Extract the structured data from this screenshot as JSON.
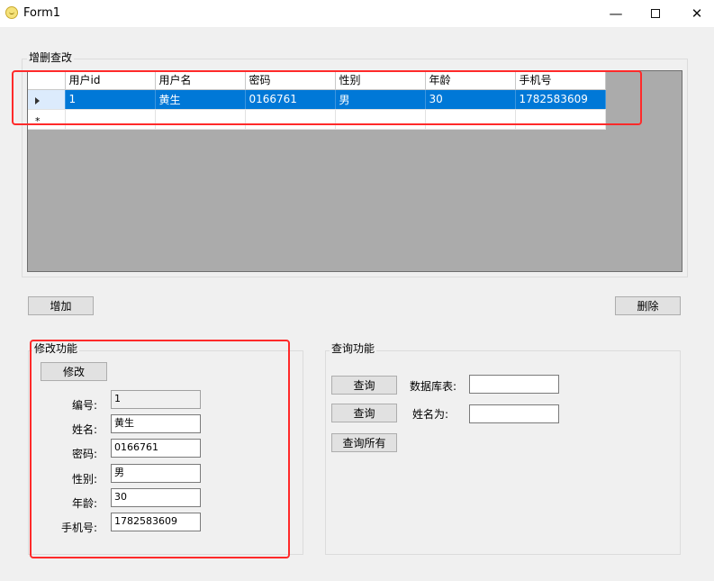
{
  "window": {
    "title": "Form1"
  },
  "crud_group": {
    "title": "增删查改"
  },
  "grid": {
    "columns": [
      "用户id",
      "用户名",
      "密码",
      "性别",
      "年龄",
      "手机号"
    ],
    "rows": [
      [
        "1",
        "黄生",
        "0166761",
        "男",
        "30",
        "1782583609"
      ]
    ],
    "new_row_marker": "*"
  },
  "buttons": {
    "add": "增加",
    "delete": "删除",
    "modify": "修改",
    "query1": "查询",
    "query2": "查询",
    "query_all": "查询所有"
  },
  "modify_group": {
    "title": "修改功能",
    "fields": [
      {
        "label": "编号:",
        "value": "1"
      },
      {
        "label": "姓名:",
        "value": "黄生"
      },
      {
        "label": "密码:",
        "value": "0166761"
      },
      {
        "label": "性别:",
        "value": "男"
      },
      {
        "label": "年龄:",
        "value": "30"
      },
      {
        "label": "手机号:",
        "value": "1782583609"
      }
    ]
  },
  "query_group": {
    "title": "查询功能",
    "table_label": "数据库表:",
    "name_label": "姓名为:",
    "table_value": "",
    "name_value": ""
  },
  "colors": {
    "selection": "#0078d7",
    "highlight_box": "#ff2a2a"
  }
}
